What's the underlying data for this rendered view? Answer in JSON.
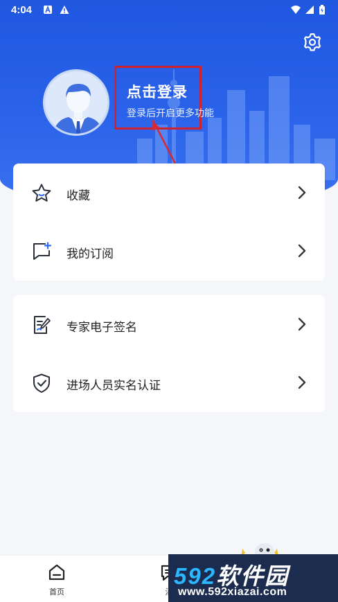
{
  "status_bar": {
    "time": "4:04",
    "icons": [
      "a-notification-icon",
      "warning-icon",
      "wifi-icon",
      "signal-icon",
      "battery-icon"
    ]
  },
  "profile": {
    "login_title": "点击登录",
    "login_subtitle": "登录后开启更多功能"
  },
  "menu_card_1": [
    {
      "icon": "star-icon",
      "label": "收藏"
    },
    {
      "icon": "subscribe-icon",
      "label": "我的订阅"
    }
  ],
  "menu_card_2": [
    {
      "icon": "signature-icon",
      "label": "专家电子签名"
    },
    {
      "icon": "shield-check-icon",
      "label": "进场人员实名认证"
    }
  ],
  "bottom_nav": [
    {
      "icon": "home-icon",
      "label": "首页"
    },
    {
      "icon": "message-icon",
      "label": "消"
    }
  ],
  "watermark": {
    "brand_number": "592",
    "brand_text": "软件园",
    "url": "www.592xiazai.com"
  },
  "colors": {
    "hero_blue": "#2a63ea",
    "annotation_red": "#d0222d",
    "text_dark": "#222222",
    "page_bg": "#f4f6f9"
  }
}
